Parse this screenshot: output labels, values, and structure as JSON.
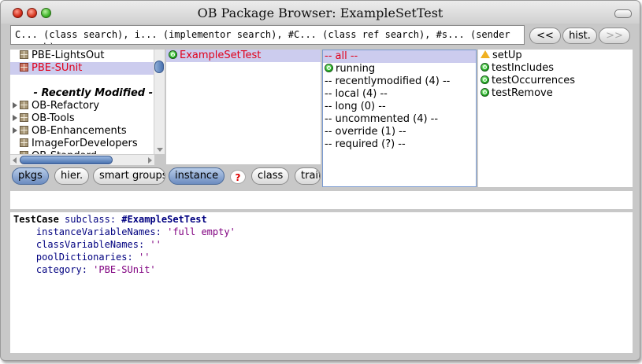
{
  "window": {
    "title": "OB Package Browser: ExampleSetTest"
  },
  "search": {
    "text": "C... (class search), i... (implementor search), #C... (class ref search), #s... (sender search)"
  },
  "nav": {
    "back_label": "<<",
    "history_label": "hist.",
    "forward_label": ">>"
  },
  "packages": {
    "items": [
      {
        "label": "PBE-LightsOut",
        "kind": "package",
        "expandable": false,
        "selected": false
      },
      {
        "label": "PBE-SUnit",
        "kind": "package",
        "expandable": false,
        "selected": true
      },
      {
        "label": "",
        "kind": "blank"
      },
      {
        "label": "- Recently Modified -",
        "kind": "header"
      },
      {
        "label": "OB-Refactory",
        "kind": "package",
        "expandable": true
      },
      {
        "label": "OB-Tools",
        "kind": "package",
        "expandable": true
      },
      {
        "label": "OB-Enhancements",
        "kind": "package",
        "expandable": true
      },
      {
        "label": "ImageForDevelopers",
        "kind": "package",
        "expandable": false
      },
      {
        "label": "OB-Standard",
        "kind": "package",
        "expandable": false
      }
    ]
  },
  "classes": {
    "items": [
      {
        "label": "ExampleSetTest",
        "selected": true
      }
    ]
  },
  "categories": {
    "items": [
      {
        "label": "-- all --",
        "selected": true
      },
      {
        "label": "running",
        "icon": "green"
      },
      {
        "label": "-- recentlymodified (4) --"
      },
      {
        "label": "-- local (4) --"
      },
      {
        "label": "-- long (0) --"
      },
      {
        "label": "-- uncommented (4) --"
      },
      {
        "label": "-- override (1) --"
      },
      {
        "label": "-- required (?) --"
      }
    ]
  },
  "methods": {
    "items": [
      {
        "label": "setUp",
        "icon": "warning"
      },
      {
        "label": "testIncludes",
        "icon": "green"
      },
      {
        "label": "testOccurrences",
        "icon": "green"
      },
      {
        "label": "testRemove",
        "icon": "green"
      }
    ]
  },
  "buttons": {
    "pkgs": "pkgs",
    "hier": "hier.",
    "smart_groups": "smart groups",
    "instance": "instance",
    "help": "?",
    "class": "class",
    "traits": "traits"
  },
  "code": {
    "line1_class": "TestCase",
    "line1_msg": "subclass:",
    "line1_sym": "#ExampleSetTest",
    "line2_kw": "instanceVariableNames:",
    "line2_val": "'full empty'",
    "line3_kw": "classVariableNames:",
    "line3_val": "''",
    "line4_kw": "poolDictionaries:",
    "line4_val": "''",
    "line5_kw": "category:",
    "line5_val": "'PBE-SUnit'"
  },
  "colors": {
    "selection": "#ccccee",
    "selected_text": "#e0001a",
    "accent_button": "#6c8cc0",
    "background": "#c8c8c8"
  }
}
